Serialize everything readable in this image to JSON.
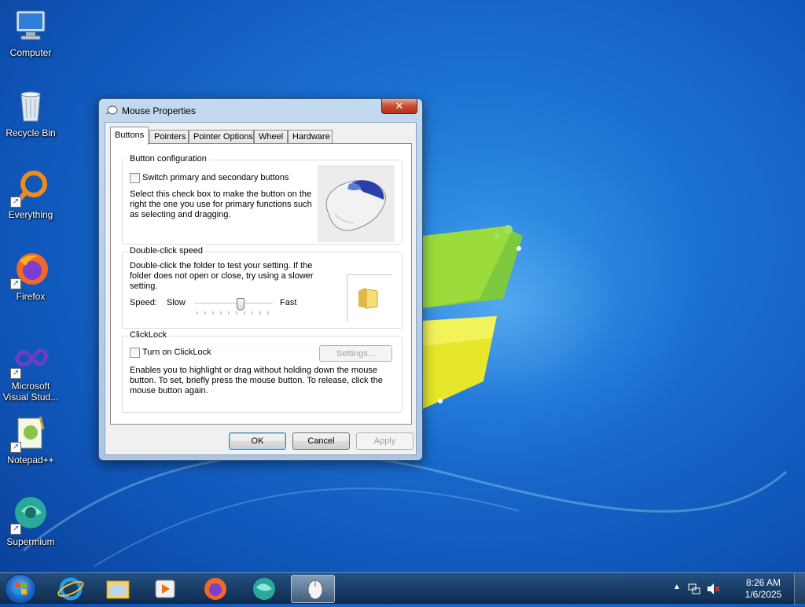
{
  "desktop": {
    "icons": [
      {
        "label": "Computer",
        "icon": "computer-icon",
        "shortcut": false
      },
      {
        "label": "Recycle Bin",
        "icon": "recycle-bin-icon",
        "shortcut": false
      },
      {
        "label": "Everything",
        "icon": "everything-icon",
        "shortcut": true
      },
      {
        "label": "Firefox",
        "icon": "firefox-icon",
        "shortcut": true
      },
      {
        "label": "Microsoft Visual Stud...",
        "icon": "visual-studio-icon",
        "shortcut": true
      },
      {
        "label": "Notepad++",
        "icon": "notepadpp-icon",
        "shortcut": true
      },
      {
        "label": "Supermium",
        "icon": "supermium-icon",
        "shortcut": true
      }
    ]
  },
  "dialog": {
    "title": "Mouse Properties",
    "close_label": "✕",
    "tabs": [
      "Buttons",
      "Pointers",
      "Pointer Options",
      "Wheel",
      "Hardware"
    ],
    "active_tab": "Buttons",
    "button_config": {
      "legend": "Button configuration",
      "checkbox_label": "Switch primary and secondary buttons",
      "checked": false,
      "description": "Select this check box to make the button on the right the one you use for primary functions such as selecting and dragging."
    },
    "double_click": {
      "legend": "Double-click speed",
      "description": "Double-click the folder to test your setting. If the folder does not open or close, try using a slower setting.",
      "speed_label": "Speed:",
      "slow_label": "Slow",
      "fast_label": "Fast",
      "speed_fraction": 0.6
    },
    "clicklock": {
      "legend": "ClickLock",
      "checkbox_label": "Turn on ClickLock",
      "checked": false,
      "settings_label": "Settings...",
      "description": "Enables you to highlight or drag without holding down the mouse button. To set, briefly press the mouse button. To release, click the mouse button again."
    },
    "buttons": {
      "ok": "OK",
      "cancel": "Cancel",
      "apply": "Apply"
    }
  },
  "taskbar": {
    "pinned": [
      "internet-explorer-icon",
      "file-explorer-icon",
      "media-player-icon",
      "firefox-icon",
      "supermium-icon",
      "mouse-properties-icon"
    ],
    "active_index": 5,
    "clock_time": "8:26 AM",
    "clock_date": "1/6/2025"
  },
  "colors": {
    "accent": "#3c7fb1",
    "close": "#c94a2f",
    "desktop": "#1a6fd0"
  }
}
